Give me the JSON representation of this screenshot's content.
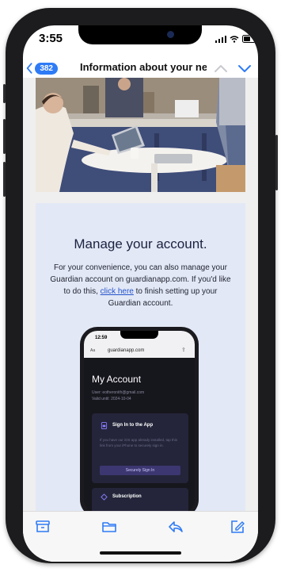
{
  "status_bar": {
    "time": "3:55"
  },
  "nav": {
    "back_count": "382",
    "title": "Information about your ne..."
  },
  "card": {
    "title": "Manage your account.",
    "body_before": "For your convenience, you can also manage your Guardian account on guardianapp.com. If you'd like to do this, ",
    "link": "click here",
    "body_after": " to finish setting up your Guardian account."
  },
  "mini_phone": {
    "time": "12:59",
    "aa": "Aa",
    "url": "guardianapp.com",
    "heading": "My Account",
    "user_line": "User: eotheronith@gmail.com",
    "valid_line": "Valid until: 2024-10-04",
    "signin_title": "Sign In to the App",
    "signin_text": "If you have our iOS app already installed, tap this link from your iPhone to securely sign in.",
    "signin_button": "Securely Sign In",
    "subscription_title": "Subscription"
  },
  "colors": {
    "accent": "#2f7bf6",
    "card_bg": "#e3e8f6",
    "link": "#2353c9"
  },
  "toolbar_icons": [
    "archive-icon",
    "folder-icon",
    "reply-icon",
    "compose-icon"
  ]
}
